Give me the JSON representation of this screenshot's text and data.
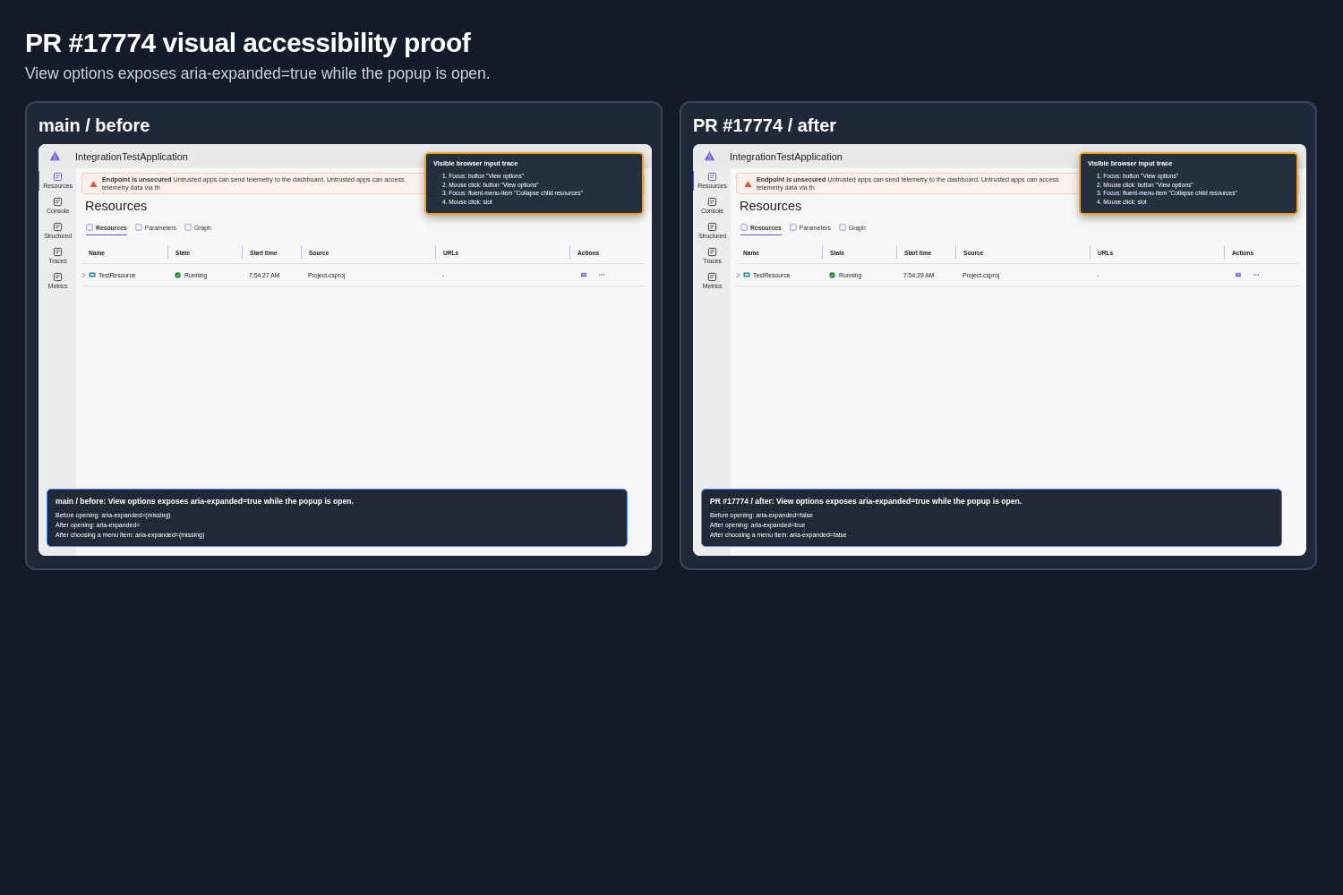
{
  "title": "PR #17774 visual accessibility proof",
  "subtitle": "View options exposes aria-expanded=true while the popup is open.",
  "panels": [
    {
      "title": "main / before",
      "app": {
        "title": "IntegrationTestApplication",
        "sidebar": [
          {
            "label": "Resources",
            "selected": true
          },
          {
            "label": "Console",
            "selected": false
          },
          {
            "label": "Structured",
            "selected": false
          },
          {
            "label": "Traces",
            "selected": false
          },
          {
            "label": "Metrics",
            "selected": false
          }
        ],
        "banner": {
          "strong": "Endpoint is unsecured",
          "message": "Untrusted apps can send telemetry to the dashboard. Untrusted apps can access telemetry data via th"
        },
        "heading": "Resources",
        "tabs": [
          {
            "label": "Resources",
            "selected": true
          },
          {
            "label": "Parameters",
            "selected": false
          },
          {
            "label": "Graph",
            "selected": false
          }
        ],
        "columns": [
          "Name",
          "State",
          "Start time",
          "Source",
          "URLs",
          "Actions"
        ],
        "rows": [
          {
            "name": "TestResource",
            "state": "Running",
            "start_time": "7:54:27 AM",
            "source": "Project.csproj",
            "urls": "-"
          }
        ]
      },
      "trace": {
        "title": "Visible browser input trace",
        "steps": [
          "1. Focus: button \"View options\"",
          "2. Mouse click: button \"View options\"",
          "3. Focus: fluent-menu-item \"Collapse child resources\"",
          "4. Mouse click: slot"
        ]
      },
      "result": {
        "title": "main / before: View options exposes aria-expanded=true while the popup is open.",
        "lines": [
          "Before opening: aria-expanded=(missing)",
          "After opening: aria-expanded=",
          "After choosing a menu item: aria-expanded=(missing)"
        ]
      }
    },
    {
      "title": "PR #17774 / after",
      "app": {
        "title": "IntegrationTestApplication",
        "sidebar": [
          {
            "label": "Resources",
            "selected": true
          },
          {
            "label": "Console",
            "selected": false
          },
          {
            "label": "Structured",
            "selected": false
          },
          {
            "label": "Traces",
            "selected": false
          },
          {
            "label": "Metrics",
            "selected": false
          }
        ],
        "banner": {
          "strong": "Endpoint is unsecured",
          "message": "Untrusted apps can send telemetry to the dashboard. Untrusted apps can access telemetry data via th"
        },
        "heading": "Resources",
        "tabs": [
          {
            "label": "Resources",
            "selected": true
          },
          {
            "label": "Parameters",
            "selected": false
          },
          {
            "label": "Graph",
            "selected": false
          }
        ],
        "columns": [
          "Name",
          "State",
          "Start time",
          "Source",
          "URLs",
          "Actions"
        ],
        "rows": [
          {
            "name": "TestResource",
            "state": "Running",
            "start_time": "7:54:39 AM",
            "source": "Project.csproj",
            "urls": "-"
          }
        ]
      },
      "trace": {
        "title": "Visible browser input trace",
        "steps": [
          "1. Focus: button \"View options\"",
          "2. Mouse click: button \"View options\"",
          "3. Focus: fluent-menu-item \"Collapse child resources\"",
          "4. Mouse click: slot"
        ]
      },
      "result": {
        "title": "PR #17774 / after: View options exposes aria-expanded=true while the popup is open.",
        "lines": [
          "Before opening: aria-expanded=false",
          "After opening: aria-expanded=true",
          "After choosing a menu item: aria-expanded=false"
        ]
      }
    }
  ]
}
